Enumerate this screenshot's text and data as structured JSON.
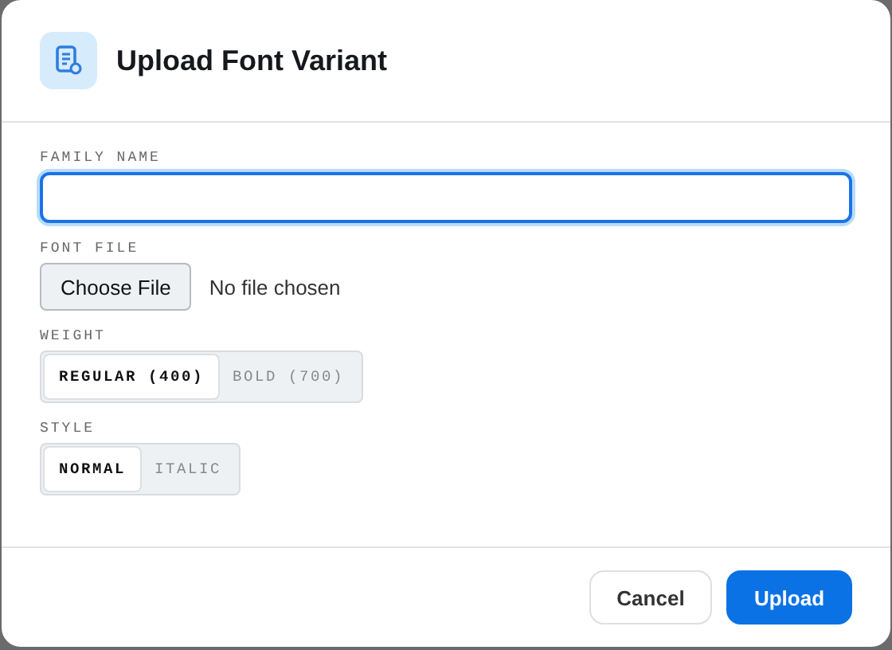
{
  "dialog": {
    "title": "Upload Font Variant"
  },
  "fields": [
    {
      "kind": "text",
      "label": "FAMILY NAME",
      "focused": true
    },
    {
      "kind": "file",
      "label": "FONT FILE",
      "button": "Choose File",
      "status": "No file chosen"
    },
    {
      "kind": "segmented",
      "label": "WEIGHT",
      "options": [
        {
          "label": "REGULAR (400)",
          "selected": true
        },
        {
          "label": "BOLD (700)",
          "selected": false
        }
      ]
    },
    {
      "kind": "segmented",
      "label": "STYLE",
      "options": [
        {
          "label": "NORMAL",
          "selected": true
        },
        {
          "label": "ITALIC",
          "selected": false
        }
      ]
    }
  ],
  "buttons": [
    {
      "kind": "secondary",
      "label": "Cancel"
    },
    {
      "kind": "primary",
      "label": "Upload"
    }
  ]
}
